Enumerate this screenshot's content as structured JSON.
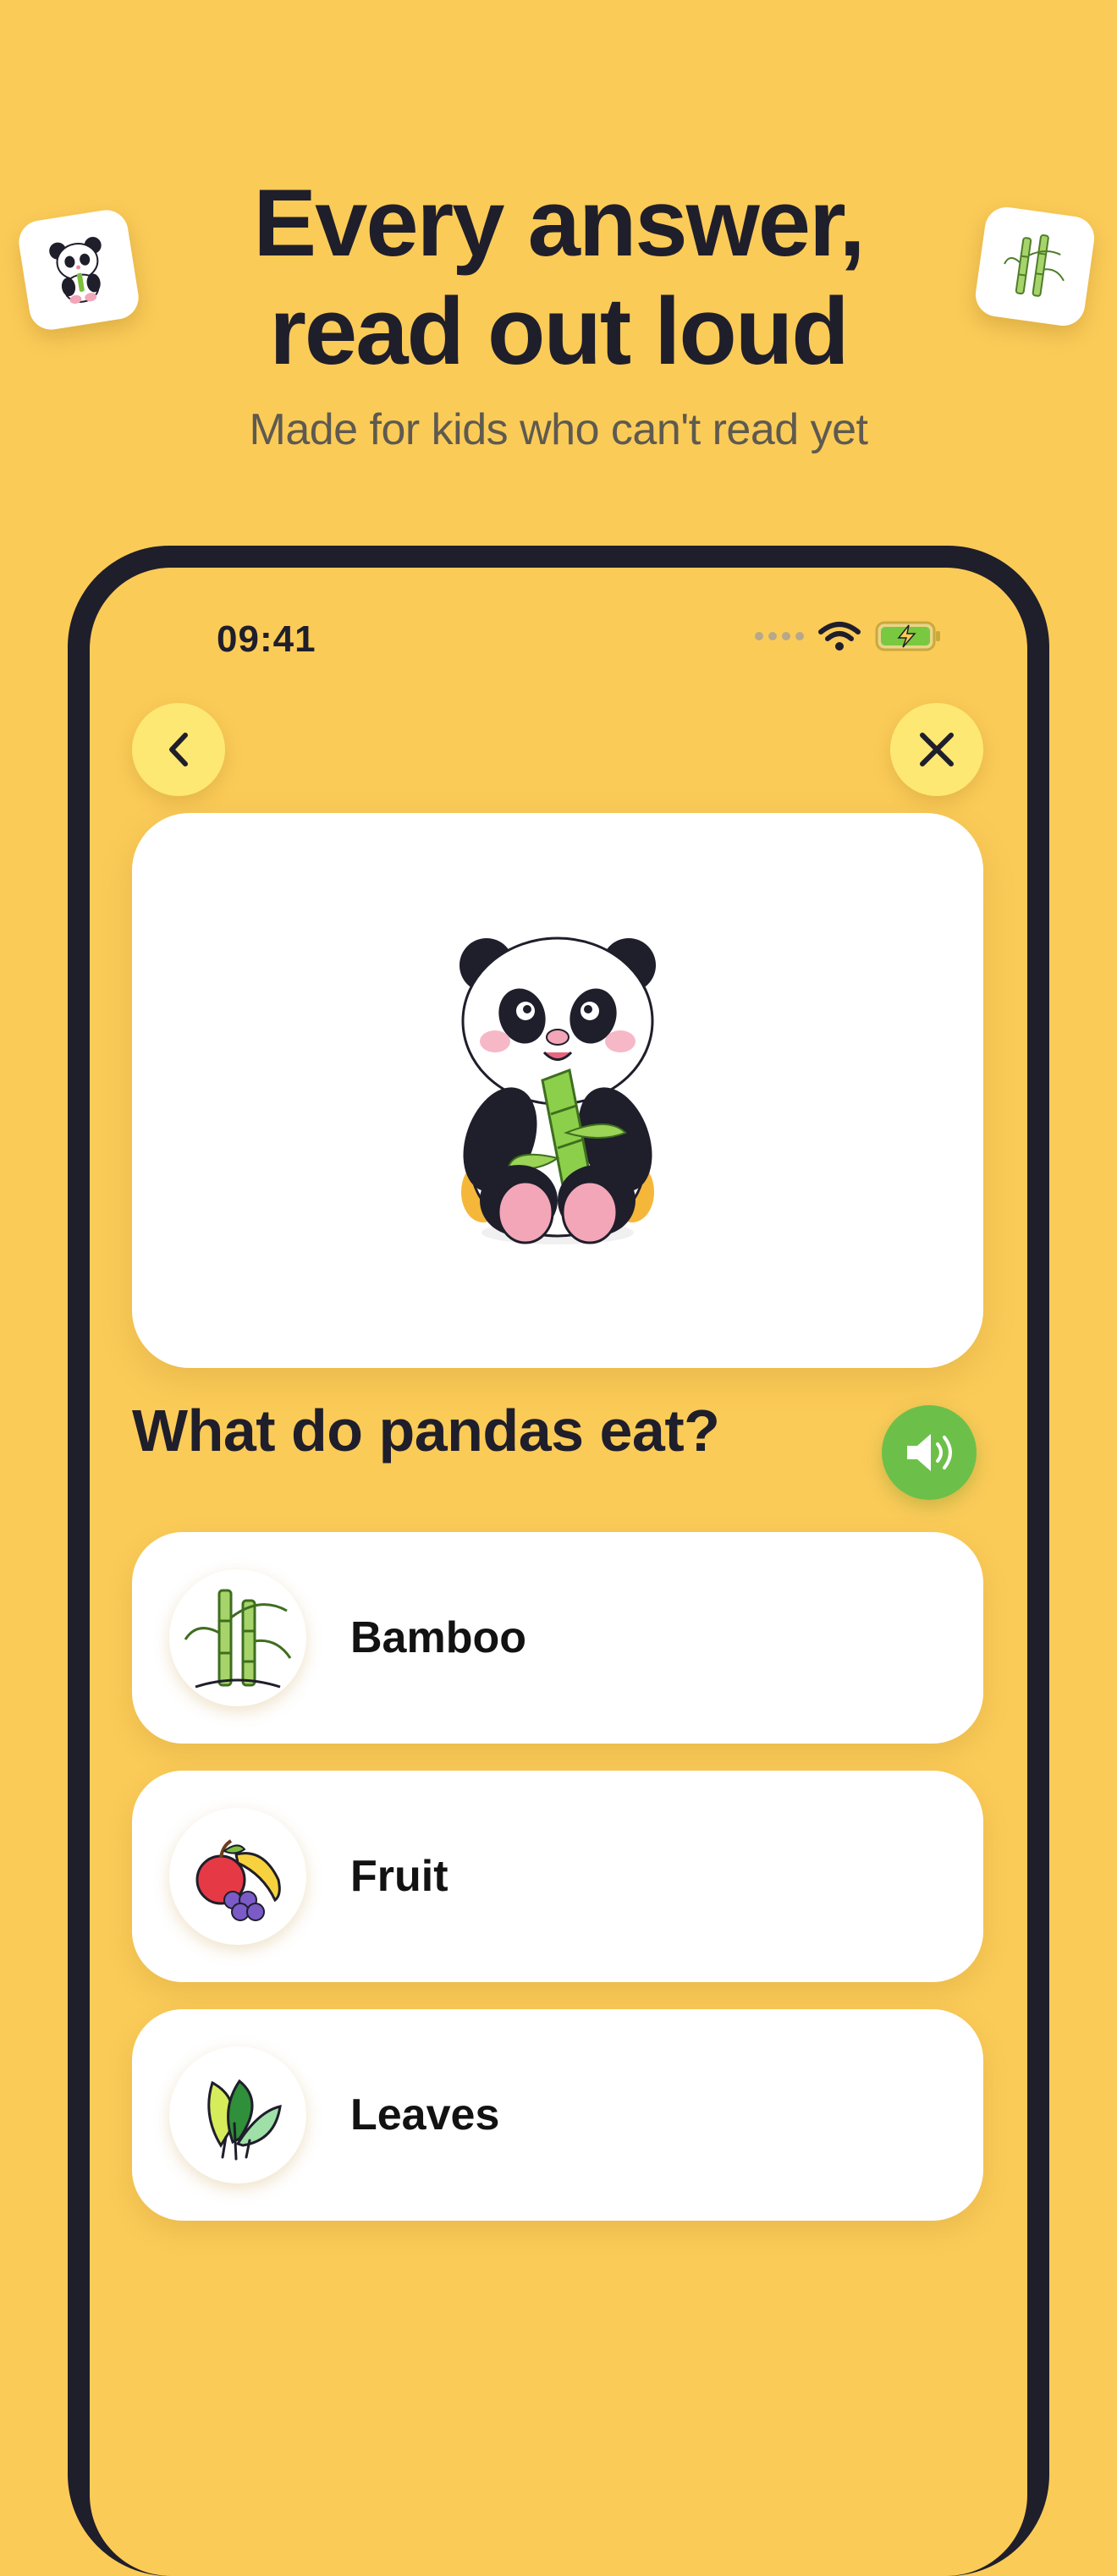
{
  "promo": {
    "headline_line1": "Every answer,",
    "headline_line2": "read out loud",
    "subtitle": "Made for kids who can't read yet",
    "background_color": "#fbcb58",
    "deco_left_icon": "panda-icon",
    "deco_right_icon": "bamboo-icon"
  },
  "phone": {
    "status_bar": {
      "time": "09:41",
      "icons": [
        "signal-dots-icon",
        "wifi-icon",
        "battery-charging-icon"
      ]
    },
    "nav": {
      "back_icon": "chevron-left-icon",
      "close_icon": "close-icon"
    },
    "question_card": {
      "image_icon": "panda-eating-bamboo-illustration"
    },
    "question": {
      "text": "What do pandas eat?",
      "sound_icon": "speaker-icon",
      "sound_color": "#6cc04a"
    },
    "answers": [
      {
        "label": "Bamboo",
        "icon": "bamboo-icon"
      },
      {
        "label": "Fruit",
        "icon": "fruit-icon"
      },
      {
        "label": "Leaves",
        "icon": "leaves-icon"
      }
    ]
  }
}
